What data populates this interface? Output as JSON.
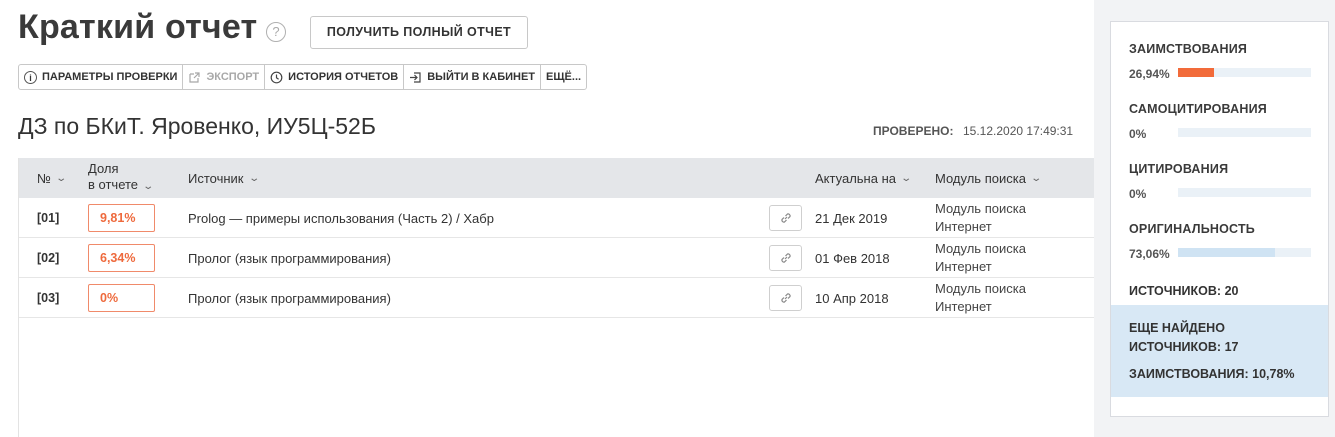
{
  "header": {
    "title": "Краткий отчет",
    "full_report_button": "ПОЛУЧИТЬ ПОЛНЫЙ ОТЧЕТ"
  },
  "toolbar": {
    "params": "ПАРАМЕТРЫ ПРОВЕРКИ",
    "export": "ЭКСПОРТ",
    "history": "ИСТОРИЯ ОТЧЕТОВ",
    "logout": "ВЫЙТИ В КАБИНЕТ",
    "more": "ЕЩЁ..."
  },
  "document": {
    "title": "ДЗ по БКиТ. Яровенко, ИУ5Ц-52Б",
    "checked_label": "ПРОВЕРЕНО:",
    "checked_value": "15.12.2020 17:49:31"
  },
  "table": {
    "headers": {
      "num": "№",
      "share_line1": "Доля",
      "share_line2": "в отчете",
      "source": "Источник",
      "actual": "Актуальна на",
      "module": "Модуль поиска"
    },
    "rows": [
      {
        "num": "[01]",
        "share": "9,81%",
        "source": "Prolog — примеры использования (Часть 2) / Хабр",
        "date": "21 Дек 2019",
        "module_line1": "Модуль поиска",
        "module_line2": "Интернет"
      },
      {
        "num": "[02]",
        "share": "6,34%",
        "source": "Пролог (язык программирования)",
        "date": "01 Фев 2018",
        "module_line1": "Модуль поиска",
        "module_line2": "Интернет"
      },
      {
        "num": "[03]",
        "share": "0%",
        "source": "Пролог (язык программирования)",
        "date": "10 Апр 2018",
        "module_line1": "Модуль поиска",
        "module_line2": "Интернет"
      }
    ]
  },
  "stats": {
    "borrowing": {
      "label": "ЗАИМСТВОВАНИЯ",
      "value": "26,94%",
      "fraction": 0.2694,
      "color": "#f26b3a"
    },
    "self_citing": {
      "label": "САМОЦИТИРОВАНИЯ",
      "value": "0%",
      "fraction": 0,
      "color": "#f5a742"
    },
    "citing": {
      "label": "ЦИТИРОВАНИЯ",
      "value": "0%",
      "fraction": 0,
      "color": "#5bb85d"
    },
    "originality": {
      "label": "ОРИГИНАЛЬНОСТЬ",
      "value": "73,06%",
      "fraction": 0.7306,
      "color": "#cfe3f3"
    },
    "sources_label": "ИСТОЧНИКОВ:",
    "sources_value": "20",
    "found_line1": "ЕЩЕ НАЙДЕНО",
    "found_line2_label": "ИСТОЧНИКОВ:",
    "found_line2_value": "17",
    "found_borrow_label": "ЗАИМСТВОВАНИЯ:",
    "found_borrow_value": "10,78%"
  }
}
